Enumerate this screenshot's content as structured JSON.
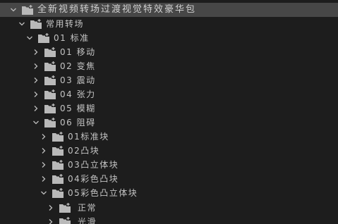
{
  "tree": {
    "root": {
      "label": "全新视频转场过渡视觉特效豪华包",
      "expanded": true
    },
    "l1": {
      "label": "常用转场",
      "expanded": true
    },
    "l2": {
      "label": "01 标准",
      "expanded": true
    },
    "l3_items": [
      {
        "label": "01 移动",
        "expanded": false
      },
      {
        "label": "02 变焦",
        "expanded": false
      },
      {
        "label": "03 震动",
        "expanded": false
      },
      {
        "label": "04 张力",
        "expanded": false
      },
      {
        "label": "05 模糊",
        "expanded": false
      },
      {
        "label": "06 阻碍",
        "expanded": true
      }
    ],
    "l4_items": [
      {
        "label": "01标准块",
        "expanded": false
      },
      {
        "label": "02凸块",
        "expanded": false
      },
      {
        "label": "03凸立体块",
        "expanded": false
      },
      {
        "label": "04彩色凸块",
        "expanded": false
      },
      {
        "label": "05彩色凸立体块",
        "expanded": true
      }
    ],
    "l5_items": [
      {
        "label": "正常",
        "expanded": false
      },
      {
        "label": "光滑",
        "expanded": false
      }
    ]
  },
  "colors": {
    "background": "#1d1d1d",
    "selected_row": "#474747",
    "text": "#c4c4c4",
    "icon": "#b9b9b9"
  },
  "icons": {
    "expanded": "chevron-down-icon",
    "collapsed": "chevron-right-icon",
    "bin": "bin-folder-icon"
  }
}
